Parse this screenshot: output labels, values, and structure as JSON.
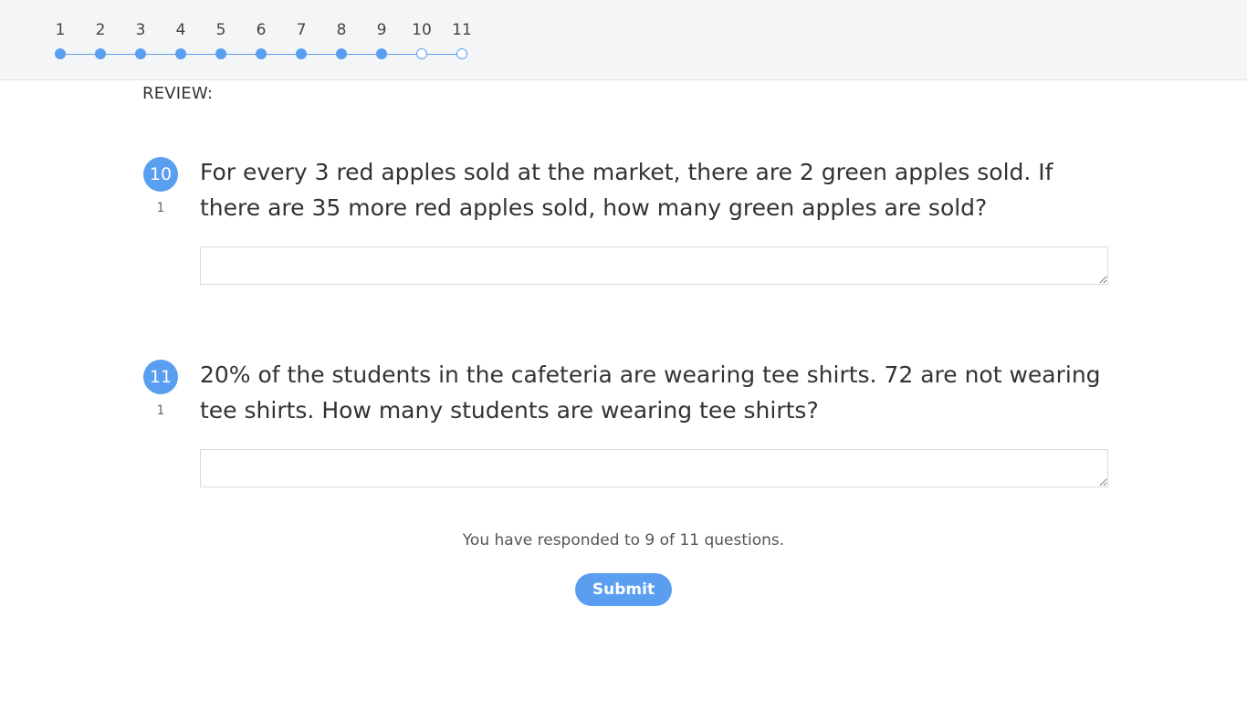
{
  "progress": {
    "steps": [
      {
        "label": "1",
        "answered": true
      },
      {
        "label": "2",
        "answered": true
      },
      {
        "label": "3",
        "answered": true
      },
      {
        "label": "4",
        "answered": true
      },
      {
        "label": "5",
        "answered": true
      },
      {
        "label": "6",
        "answered": true
      },
      {
        "label": "7",
        "answered": true
      },
      {
        "label": "8",
        "answered": true
      },
      {
        "label": "9",
        "answered": true
      },
      {
        "label": "10",
        "answered": false
      },
      {
        "label": "11",
        "answered": false
      }
    ],
    "accent_color": "#5a9ef0"
  },
  "review_label": "REVIEW:",
  "questions": [
    {
      "number": "10",
      "points": "1",
      "text": "For every 3 red apples sold at the market, there are 2 green apples sold.  If there are 35 more red apples sold, how many green apples are sold?",
      "answer": ""
    },
    {
      "number": "11",
      "points": "1",
      "text": "20% of the students in the cafeteria are wearing tee shirts.  72 are not wearing tee shirts.  How many students are wearing tee shirts?",
      "answer": ""
    }
  ],
  "status_text": "You have responded to 9 of 11 questions.",
  "submit_label": "Submit"
}
